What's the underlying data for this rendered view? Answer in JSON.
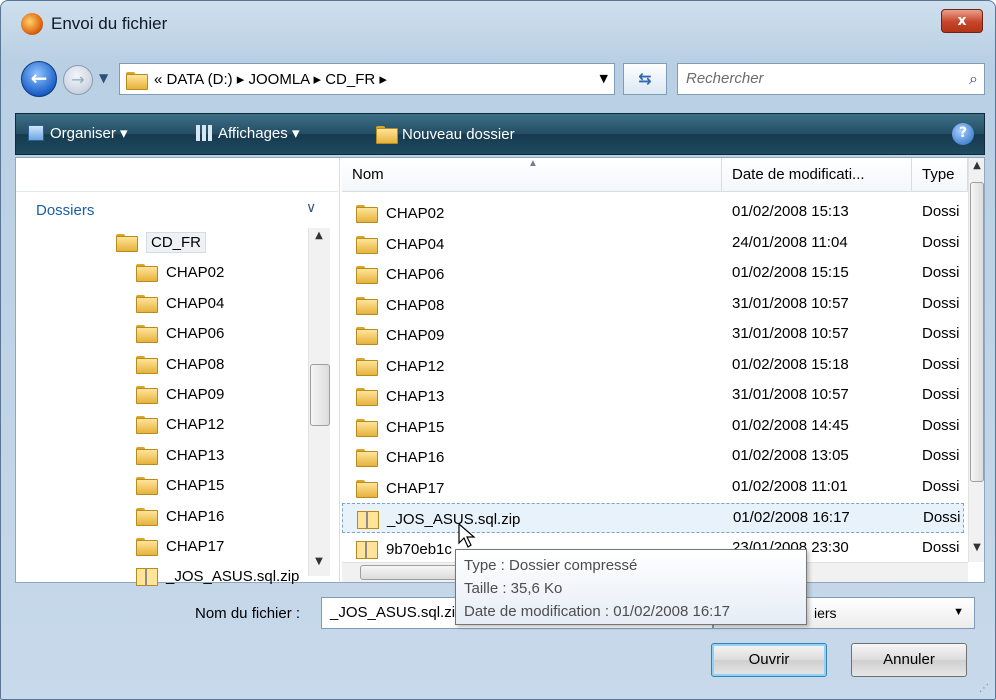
{
  "window": {
    "title": "Envoi du fichier",
    "close_label": "x"
  },
  "address_bar": {
    "crumbs": "« DATA (D:) ▸ JOOMLA ▸ CD_FR ▸",
    "search_placeholder": "Rechercher"
  },
  "toolbar": {
    "organise": "Organiser ▾",
    "views": "Affichages ▾",
    "new_folder": "Nouveau dossier",
    "help": "?"
  },
  "left_pane": {
    "header": "Dossiers",
    "items": [
      "CD_FR",
      "CHAP02",
      "CHAP04",
      "CHAP06",
      "CHAP08",
      "CHAP09",
      "CHAP12",
      "CHAP13",
      "CHAP15",
      "CHAP16",
      "CHAP17",
      "_JOS_ASUS.sql.zip"
    ]
  },
  "file_list": {
    "columns": [
      "Nom",
      "Date de modificati...",
      "Type"
    ],
    "rows": [
      {
        "name": "CHAP02",
        "date": "01/02/2008 15:13",
        "type": "Dossi",
        "icon": "folder-icon"
      },
      {
        "name": "CHAP04",
        "date": "24/01/2008 11:04",
        "type": "Dossi",
        "icon": "folder-icon"
      },
      {
        "name": "CHAP06",
        "date": "01/02/2008 15:15",
        "type": "Dossi",
        "icon": "folder-icon"
      },
      {
        "name": "CHAP08",
        "date": "31/01/2008 10:57",
        "type": "Dossi",
        "icon": "folder-icon"
      },
      {
        "name": "CHAP09",
        "date": "31/01/2008 10:57",
        "type": "Dossi",
        "icon": "folder-icon"
      },
      {
        "name": "CHAP12",
        "date": "01/02/2008 15:18",
        "type": "Dossi",
        "icon": "folder-icon"
      },
      {
        "name": "CHAP13",
        "date": "31/01/2008 10:57",
        "type": "Dossi",
        "icon": "folder-icon"
      },
      {
        "name": "CHAP15",
        "date": "01/02/2008 14:45",
        "type": "Dossi",
        "icon": "folder-icon"
      },
      {
        "name": "CHAP16",
        "date": "01/02/2008 13:05",
        "type": "Dossi",
        "icon": "folder-icon"
      },
      {
        "name": "CHAP17",
        "date": "01/02/2008 11:01",
        "type": "Dossi",
        "icon": "folder-icon"
      },
      {
        "name": "_JOS_ASUS.sql.zip",
        "date": "01/02/2008 16:17",
        "type": "Dossi",
        "icon": "zip-icon"
      },
      {
        "name": "9b70eb1c",
        "date": "23/01/2008 23:30",
        "type": "Dossi",
        "icon": "zip-icon"
      }
    ]
  },
  "tooltip": {
    "line1": "Type : Dossier compressé",
    "line2": "Taille : 35,6 Ko",
    "line3": "Date de modification : 01/02/2008 16:17"
  },
  "footer": {
    "filename_label": "Nom du fichier :",
    "filename_value": "_JOS_ASUS.sql.zip",
    "filetype_value": "iers",
    "open_button": "Ouvrir",
    "cancel_button": "Annuler"
  }
}
